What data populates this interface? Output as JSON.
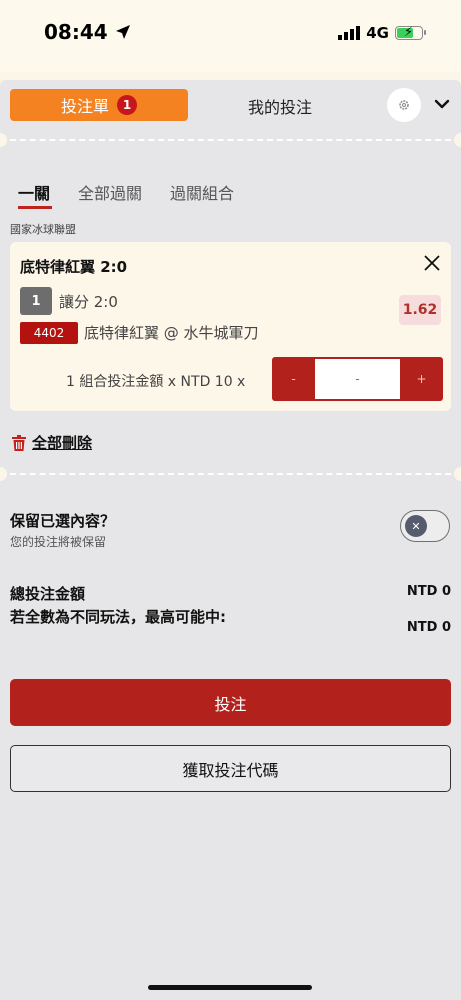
{
  "status_bar": {
    "time": "08:44",
    "network": "4G"
  },
  "tabs": {
    "bet_slip_label": "投注單",
    "bet_slip_count": "1",
    "my_bets_label": "我的投注"
  },
  "subtabs": [
    "一關",
    "全部過關",
    "過關組合"
  ],
  "league": "國家冰球聯盟",
  "selection": {
    "title": "底特律紅翼 2:0",
    "number": "1",
    "market": "讓分 2:0",
    "odds": "1.62",
    "event_code": "4402",
    "event_name": "底特律紅翼 @ 水牛城軍刀",
    "stake_label": "1 組合投注金額 x NTD 10 x",
    "stake_minus": "-",
    "stake_placeholder": "-",
    "stake_plus": "+"
  },
  "delete_all_label": "全部刪除",
  "retain": {
    "title": "保留已選內容？",
    "subtitle": "您的投注將被保留",
    "enabled": false
  },
  "totals": {
    "total_label": "總投注金額",
    "total_value": "NTD 0",
    "max_win_label": "若全數為不同玩法，最高可能中:",
    "max_win_value": "NTD 0"
  },
  "buttons": {
    "place_bet": "投注",
    "get_code": "獲取投注代碼"
  },
  "colors": {
    "accent_orange": "#f58220",
    "brand_red": "#b3211c",
    "panel_bg": "#e6e5e7",
    "card_bg": "#fdf7ea"
  }
}
